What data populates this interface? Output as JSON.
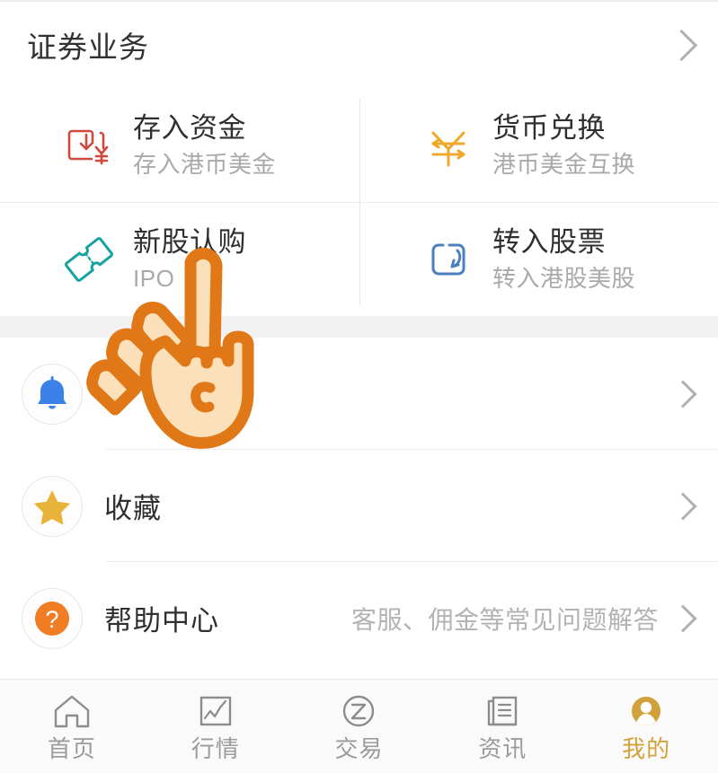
{
  "section": {
    "title": "证券业务",
    "chevron_icon": "chevron-right-icon"
  },
  "services": [
    {
      "title": "存入资金",
      "subtitle": "存入港币美金",
      "icon": "deposit-funds-icon",
      "color": "#d0493c"
    },
    {
      "title": "货币兑换",
      "subtitle": "港币美金互换",
      "icon": "currency-exchange-icon",
      "color": "#f0a828"
    },
    {
      "title": "新股认购",
      "subtitle": "IPO",
      "icon": "ipo-ticket-icon",
      "color": "#17a2a2"
    },
    {
      "title": "转入股票",
      "subtitle": "转入港股美股",
      "icon": "transfer-in-stock-icon",
      "color": "#4a7fc1"
    }
  ],
  "list": [
    {
      "label": "",
      "subtitle": "",
      "icon": "bell-icon",
      "icon_color": "#3b82e8",
      "has_badge": true
    },
    {
      "label": "收藏",
      "subtitle": "",
      "icon": "star-icon",
      "icon_color": "#e8b339",
      "has_badge": false
    },
    {
      "label": "帮助中心",
      "subtitle": "客服、佣金等常见问题解答",
      "icon": "question-mark-icon",
      "icon_color": "#f07c24",
      "has_badge": false
    }
  ],
  "tabbar": {
    "active_color": "#d2a13c",
    "inactive_color": "#9b9b9b",
    "items": [
      {
        "label": "首页",
        "icon": "home-icon",
        "active": false
      },
      {
        "label": "行情",
        "icon": "chart-icon",
        "active": false
      },
      {
        "label": "交易",
        "icon": "trade-circle-z-icon",
        "active": false
      },
      {
        "label": "资讯",
        "icon": "news-icon",
        "active": false
      },
      {
        "label": "我的",
        "icon": "person-avatar-icon",
        "active": true
      }
    ]
  },
  "overlay": {
    "cursor_icon": "pointing-hand-cursor",
    "outline_color": "#e07818",
    "fill_color": "#fbe0ba"
  }
}
